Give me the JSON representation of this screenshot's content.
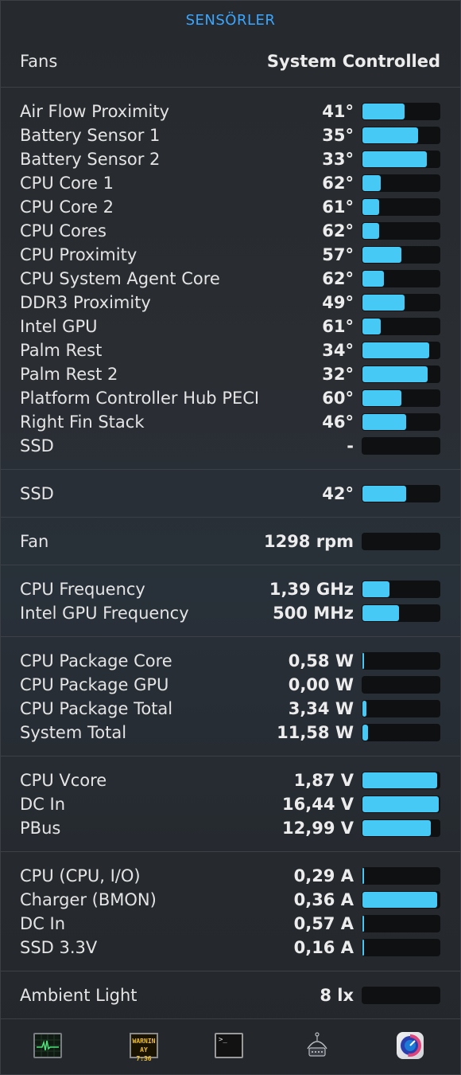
{
  "header": {
    "title": "SENSÖRLER"
  },
  "fans": {
    "label": "Fans",
    "value": "System Controlled"
  },
  "temperature_sensors": [
    {
      "label": "Air Flow Proximity",
      "value": "41°",
      "level": 0.55
    },
    {
      "label": "Battery Sensor 1",
      "value": "35°",
      "level": 0.72
    },
    {
      "label": "Battery Sensor 2",
      "value": "33°",
      "level": 0.84
    },
    {
      "label": "CPU Core 1",
      "value": "62°",
      "level": 0.24
    },
    {
      "label": "CPU Core 2",
      "value": "61°",
      "level": 0.22
    },
    {
      "label": "CPU Cores",
      "value": "62°",
      "level": 0.22
    },
    {
      "label": "CPU Proximity",
      "value": "57°",
      "level": 0.51
    },
    {
      "label": "CPU System Agent Core",
      "value": "62°",
      "level": 0.28
    },
    {
      "label": "DDR3 Proximity",
      "value": "49°",
      "level": 0.55
    },
    {
      "label": "Intel GPU",
      "value": "61°",
      "level": 0.24
    },
    {
      "label": "Palm Rest",
      "value": "34°",
      "level": 0.87
    },
    {
      "label": "Palm Rest 2",
      "value": "32°",
      "level": 0.85
    },
    {
      "label": "Platform Controller Hub PECI",
      "value": "60°",
      "level": 0.51
    },
    {
      "label": "Right Fin Stack",
      "value": "46°",
      "level": 0.57
    },
    {
      "label": "SSD",
      "value": "-",
      "level": 0
    }
  ],
  "ssd_sensors": [
    {
      "label": "SSD",
      "value": "42°",
      "level": 0.57
    }
  ],
  "fan_sensors": [
    {
      "label": "Fan",
      "value": "1298 rpm",
      "level": 0
    }
  ],
  "frequency_sensors": [
    {
      "label": "CPU Frequency",
      "value": "1,39 GHz",
      "level": 0.35
    },
    {
      "label": "Intel GPU Frequency",
      "value": "500 MHz",
      "level": 0.47
    }
  ],
  "power_sensors": [
    {
      "label": "CPU Package Core",
      "value": "0,58 W",
      "level": 0.02
    },
    {
      "label": "CPU Package GPU",
      "value": "0,00 W",
      "level": 0
    },
    {
      "label": "CPU Package Total",
      "value": "3,34 W",
      "level": 0.05
    },
    {
      "label": "System Total",
      "value": "11,58 W",
      "level": 0.07
    }
  ],
  "voltage_sensors": [
    {
      "label": "CPU Vcore",
      "value": "1,87 V",
      "level": 0.97
    },
    {
      "label": "DC In",
      "value": "16,44 V",
      "level": 0.99
    },
    {
      "label": "PBus",
      "value": "12,99 V",
      "level": 0.89
    }
  ],
  "current_sensors": [
    {
      "label": "CPU (CPU, I/O)",
      "value": "0,29 A",
      "level": 0.02
    },
    {
      "label": "Charger (BMON)",
      "value": "0,36 A",
      "level": 0.97
    },
    {
      "label": "DC In",
      "value": "0,57 A",
      "level": 0.02
    },
    {
      "label": "SSD 3.3V",
      "value": "0,16 A",
      "level": 0.02
    }
  ],
  "light_sensors": [
    {
      "label": "Ambient Light",
      "value": "8 lx",
      "level": 0
    }
  ],
  "footer": {
    "console_icon_text": [
      "WARNIN",
      "AY 7:36"
    ],
    "terminal_icon_text": ">_",
    "icons": [
      "activity-monitor-icon",
      "console-icon",
      "terminal-icon",
      "system-information-icon",
      "istat-menus-icon"
    ]
  },
  "colors": {
    "accent": "#3aa6ff",
    "bar_fill": "#47c9f5",
    "bar_track": "#0f1012"
  }
}
